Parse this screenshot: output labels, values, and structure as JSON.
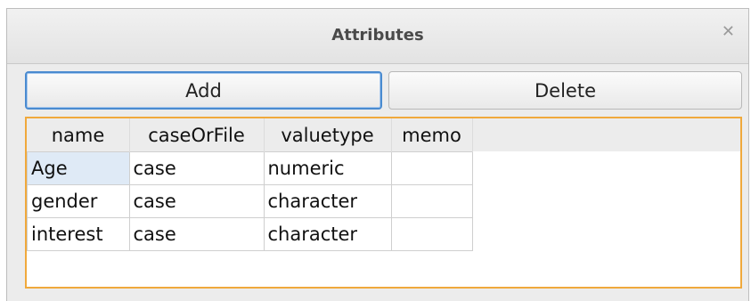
{
  "window": {
    "title": "Attributes"
  },
  "toolbar": {
    "add_label": "Add",
    "delete_label": "Delete"
  },
  "table": {
    "columns": [
      "name",
      "caseOrFile",
      "valuetype",
      "memo"
    ],
    "rows": [
      [
        "Age",
        "case",
        "numeric",
        ""
      ],
      [
        "gender",
        "case",
        "character",
        ""
      ],
      [
        "interest",
        "case",
        "character",
        ""
      ]
    ]
  },
  "colors": {
    "focus_border": "#f0a93c",
    "button_focus": "#4a8bd0",
    "selected_cell": "#dfeaf6"
  },
  "icons": {
    "close": "close-icon"
  }
}
